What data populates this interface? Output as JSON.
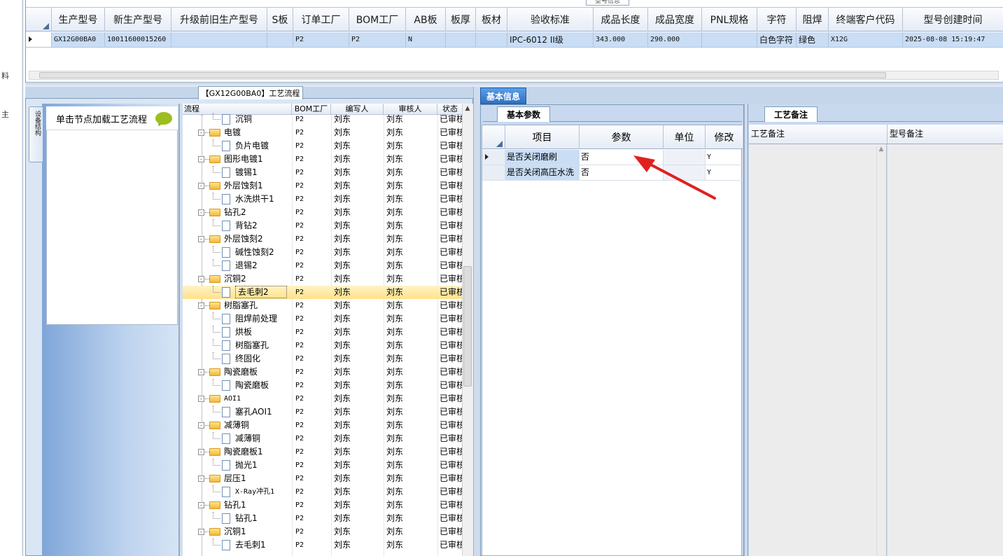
{
  "left_strip": {
    "chars": [
      "料",
      "主"
    ]
  },
  "top_grid": {
    "caption": "型号信息",
    "columns": [
      "生产型号",
      "新生产型号",
      "升级前旧生产型号",
      "S板",
      "订单工厂",
      "BOM工厂",
      "AB板",
      "板厚",
      "板材",
      "验收标准",
      "成品长度",
      "成品宽度",
      "PNL规格",
      "字符",
      "阻焊",
      "终端客户代码",
      "型号创建时间"
    ],
    "row": [
      "GX12G00BA0",
      "10011600015260",
      "",
      "",
      "P2",
      "P2",
      "N",
      "",
      "",
      "IPC-6012 II级",
      "343.000",
      "290.000",
      "",
      "白色字符",
      "绿色",
      "X12G",
      "2025-08-08 15:19:47"
    ]
  },
  "flow": {
    "caption": "【GX12G00BA0】工艺流程",
    "vertical_tab": "设备结构",
    "nav_title": "单击节点加载工艺流程",
    "columns": [
      "流程",
      "BOM工厂",
      "编写人",
      "审核人",
      "状态"
    ],
    "rows": [
      {
        "name": "沉铜",
        "type": "child",
        "bom": "P2",
        "writer": "刘东",
        "auditor": "刘东",
        "status": "已审核"
      },
      {
        "name": "电镀",
        "type": "folder",
        "bom": "P2",
        "writer": "刘东",
        "auditor": "刘东",
        "status": "已审核"
      },
      {
        "name": "负片电镀",
        "type": "child",
        "bom": "P2",
        "writer": "刘东",
        "auditor": "刘东",
        "status": "已审核"
      },
      {
        "name": "图形电镀1",
        "type": "folder",
        "bom": "P2",
        "writer": "刘东",
        "auditor": "刘东",
        "status": "已审核"
      },
      {
        "name": "镀锡1",
        "type": "child",
        "bom": "P2",
        "writer": "刘东",
        "auditor": "刘东",
        "status": "已审核"
      },
      {
        "name": "外层蚀刻1",
        "type": "folder",
        "bom": "P2",
        "writer": "刘东",
        "auditor": "刘东",
        "status": "已审核"
      },
      {
        "name": "水洗烘干1",
        "type": "child",
        "bom": "P2",
        "writer": "刘东",
        "auditor": "刘东",
        "status": "已审核"
      },
      {
        "name": "钻孔2",
        "type": "folder",
        "bom": "P2",
        "writer": "刘东",
        "auditor": "刘东",
        "status": "已审核"
      },
      {
        "name": "背钻2",
        "type": "child",
        "bom": "P2",
        "writer": "刘东",
        "auditor": "刘东",
        "status": "已审核"
      },
      {
        "name": "外层蚀刻2",
        "type": "folder",
        "bom": "P2",
        "writer": "刘东",
        "auditor": "刘东",
        "status": "已审核"
      },
      {
        "name": "碱性蚀刻2",
        "type": "child",
        "bom": "P2",
        "writer": "刘东",
        "auditor": "刘东",
        "status": "已审核"
      },
      {
        "name": "退锡2",
        "type": "child",
        "bom": "P2",
        "writer": "刘东",
        "auditor": "刘东",
        "status": "已审核"
      },
      {
        "name": "沉铜2",
        "type": "folder",
        "bom": "P2",
        "writer": "刘东",
        "auditor": "刘东",
        "status": "已审核"
      },
      {
        "name": "去毛刺2",
        "type": "child",
        "bom": "P2",
        "writer": "刘东",
        "auditor": "刘东",
        "status": "已审核",
        "selected": true
      },
      {
        "name": "树脂塞孔",
        "type": "folder",
        "bom": "P2",
        "writer": "刘东",
        "auditor": "刘东",
        "status": "已审核"
      },
      {
        "name": "阻焊前处理",
        "type": "child",
        "bom": "P2",
        "writer": "刘东",
        "auditor": "刘东",
        "status": "已审核"
      },
      {
        "name": "烘板",
        "type": "child",
        "bom": "P2",
        "writer": "刘东",
        "auditor": "刘东",
        "status": "已审核"
      },
      {
        "name": "树脂塞孔",
        "type": "child",
        "bom": "P2",
        "writer": "刘东",
        "auditor": "刘东",
        "status": "已审核"
      },
      {
        "name": "终固化",
        "type": "child",
        "bom": "P2",
        "writer": "刘东",
        "auditor": "刘东",
        "status": "已审核"
      },
      {
        "name": "陶瓷磨板",
        "type": "folder",
        "bom": "P2",
        "writer": "刘东",
        "auditor": "刘东",
        "status": "已审核"
      },
      {
        "name": "陶瓷磨板",
        "type": "child",
        "bom": "P2",
        "writer": "刘东",
        "auditor": "刘东",
        "status": "已审核"
      },
      {
        "name": "AOI1",
        "type": "folder",
        "bom": "P2",
        "writer": "刘东",
        "auditor": "刘东",
        "status": "已审核"
      },
      {
        "name": "塞孔AOI1",
        "type": "child",
        "bom": "P2",
        "writer": "刘东",
        "auditor": "刘东",
        "status": "已审核"
      },
      {
        "name": "减薄铜",
        "type": "folder",
        "bom": "P2",
        "writer": "刘东",
        "auditor": "刘东",
        "status": "已审核"
      },
      {
        "name": "减薄铜",
        "type": "child",
        "bom": "P2",
        "writer": "刘东",
        "auditor": "刘东",
        "status": "已审核"
      },
      {
        "name": "陶瓷磨板1",
        "type": "folder",
        "bom": "P2",
        "writer": "刘东",
        "auditor": "刘东",
        "status": "已审核"
      },
      {
        "name": "抛光1",
        "type": "child",
        "bom": "P2",
        "writer": "刘东",
        "auditor": "刘东",
        "status": "已审核"
      },
      {
        "name": "层压1",
        "type": "folder",
        "bom": "P2",
        "writer": "刘东",
        "auditor": "刘东",
        "status": "已审核"
      },
      {
        "name": "X-Ray冲孔1",
        "type": "child",
        "bom": "P2",
        "writer": "刘东",
        "auditor": "刘东",
        "status": "已审核"
      },
      {
        "name": "钻孔1",
        "type": "folder",
        "bom": "P2",
        "writer": "刘东",
        "auditor": "刘东",
        "status": "已审核"
      },
      {
        "name": "钻孔1",
        "type": "child",
        "bom": "P2",
        "writer": "刘东",
        "auditor": "刘东",
        "status": "已审核"
      },
      {
        "name": "沉铜1",
        "type": "folder",
        "bom": "P2",
        "writer": "刘东",
        "auditor": "刘东",
        "status": "已审核"
      },
      {
        "name": "去毛刺1",
        "type": "child",
        "bom": "P2",
        "writer": "刘东",
        "auditor": "刘东",
        "status": "已审核"
      }
    ]
  },
  "basic_info": {
    "tab": "基本信息",
    "sub_tab": "基本参数",
    "columns": [
      "项目",
      "参数",
      "单位",
      "修改"
    ],
    "rows": [
      {
        "item": "是否关闭磨刷",
        "param": "否",
        "unit": "",
        "modify": "Y"
      },
      {
        "item": "是否关闭高压水洗",
        "param": "否",
        "unit": "",
        "modify": "Y"
      }
    ]
  },
  "remarks": {
    "tab": "工艺备注",
    "columns": [
      "工艺备注",
      "型号备注"
    ]
  },
  "annotation": {
    "color": "#e02020"
  },
  "colors": {
    "selection": "#c9ddf5",
    "accent_tab": "#2e6fc4",
    "tree_selected": "#ffe28a"
  }
}
